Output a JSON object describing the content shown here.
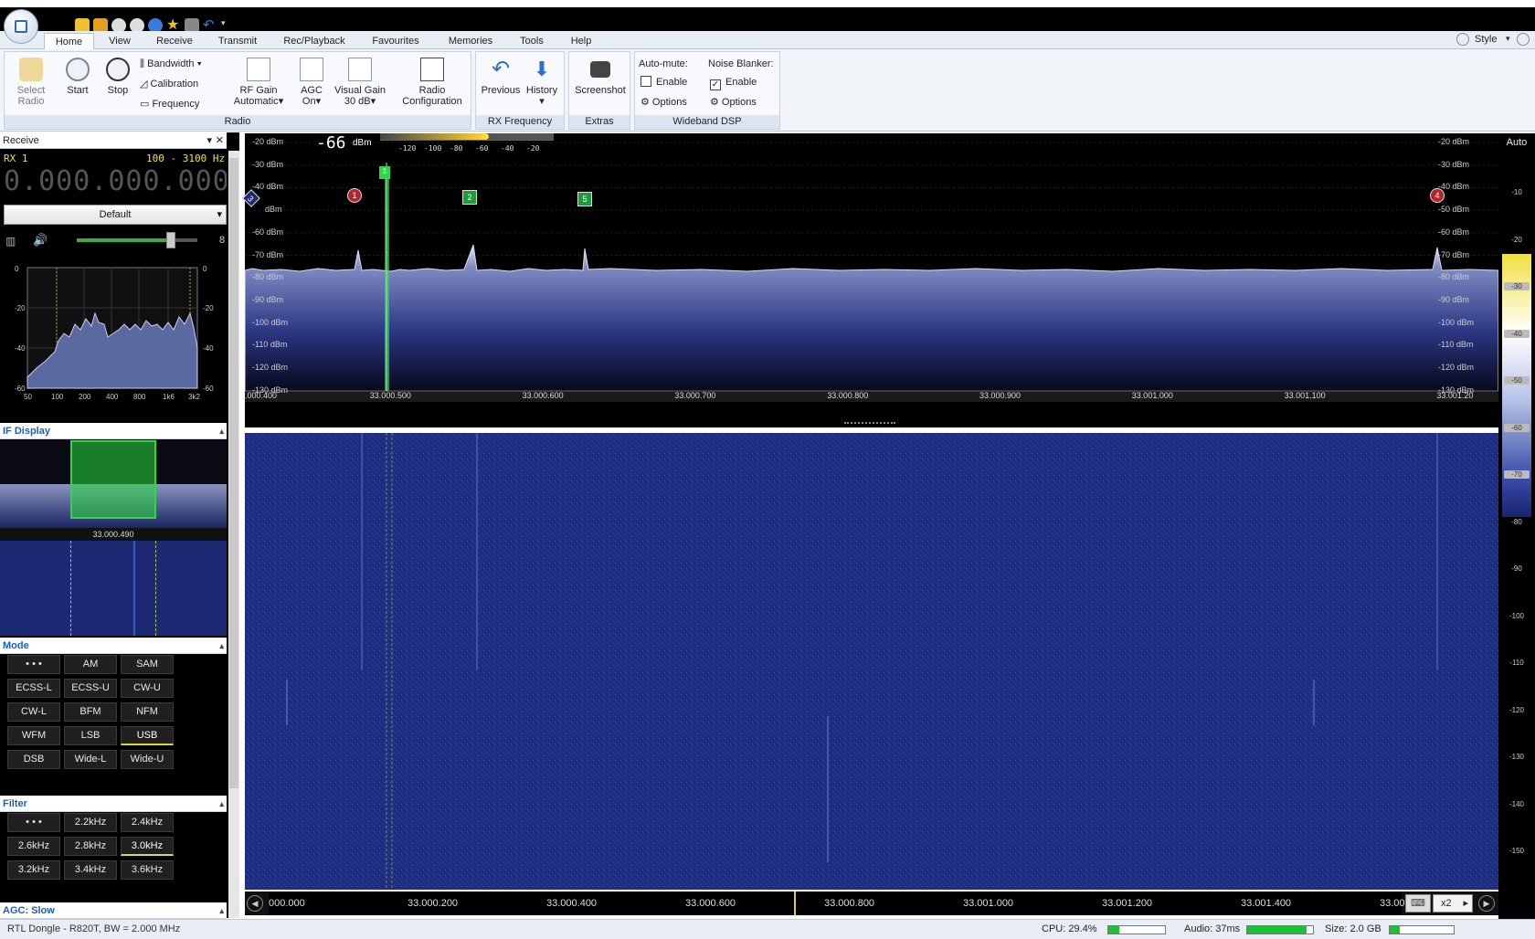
{
  "quick_access": [
    "home-icon",
    "folder-icon",
    "play-icon",
    "stop-icon",
    "add-icon",
    "favourite-icon",
    "camera-icon",
    "undo-icon"
  ],
  "tabs": [
    {
      "label": "Home"
    },
    {
      "label": "View"
    },
    {
      "label": "Receive"
    },
    {
      "label": "Transmit"
    },
    {
      "label": "Rec/Playback"
    },
    {
      "label": "Favourites"
    },
    {
      "label": "Memories"
    },
    {
      "label": "Tools"
    },
    {
      "label": "Help"
    }
  ],
  "style_label": "Style",
  "ribbon": {
    "select_radio": "Select\nRadio",
    "start": "Start",
    "stop": "Stop",
    "bandwidth": "Bandwidth",
    "calibration": "Calibration",
    "frequency": "Frequency",
    "rf_gain": "RF Gain",
    "rf_gain_val": "Automatic",
    "agc": "AGC",
    "agc_val": "On",
    "visual_gain": "Visual Gain",
    "visual_gain_val": "30 dB",
    "radio_config": "Radio",
    "radio_config2": "Configuration",
    "radio_group": "Radio",
    "previous": "Previous",
    "history": "History",
    "rxfreq_group": "RX Frequency",
    "screenshot": "Screenshot",
    "extras_group": "Extras",
    "automute": "Auto-mute:",
    "automute_enable": "Enable",
    "automute_options": "Options",
    "noise_blanker": "Noise Blanker:",
    "nb_enable": "Enable",
    "nb_options": "Options",
    "wideband_group": "Wideband DSP"
  },
  "receive": {
    "title": "Receive",
    "rx": "RX 1",
    "bw": "100 - 3100 Hz",
    "freq": "0.000.000.000",
    "preset": "Default",
    "volume": 0.78,
    "vol_label": "8"
  },
  "audio_spectrum": {
    "left_scale": [
      "0",
      "-20",
      "-40",
      "-60"
    ],
    "right_scale": [
      "0",
      "-20",
      "-40",
      "-60"
    ],
    "freqs": [
      "50",
      "100",
      "200",
      "400",
      "800",
      "1k6",
      "3k2"
    ]
  },
  "if_display": {
    "title": "IF Display",
    "freq": "33.000.490"
  },
  "mode": {
    "title": "Mode",
    "buttons": [
      "• • •",
      "AM",
      "SAM",
      "ECSS-L",
      "ECSS-U",
      "CW-U",
      "CW-L",
      "BFM",
      "NFM",
      "WFM",
      "LSB",
      "USB",
      "DSB",
      "Wide-L",
      "Wide-U"
    ],
    "selected": "USB"
  },
  "filter": {
    "title": "Filter",
    "buttons": [
      "• • •",
      "2.2kHz",
      "2.4kHz",
      "2.6kHz",
      "2.8kHz",
      "3.0kHz",
      "3.2kHz",
      "3.4kHz",
      "3.6kHz"
    ],
    "selected": "3.0kHz"
  },
  "agc_label": "AGC: Slow",
  "spectrum": {
    "signal_value": "-66",
    "signal_unit": "dBm",
    "smeter_ticks": [
      "-120",
      "-100",
      "-80",
      "-60",
      "-40",
      "-20"
    ],
    "dbm_labels": [
      "-20 dBm",
      "-30 dBm",
      "-40 dBm",
      "-50 dBm",
      "-60 dBm",
      "-70 dBm",
      "-80 dBm",
      "-90 dBm",
      "-100 dBm",
      "-110 dBm",
      "-120 dBm",
      "-130 dBm"
    ],
    "dbm_left_partial": "dBm",
    "freq_labels": [
      ".000.400",
      "33.000.500",
      "33.000.600",
      "33.000.700",
      "33.000.800",
      "33.000.900",
      "33.001.000",
      "33.001.100",
      "33.001.20"
    ],
    "markers": [
      {
        "id": "1",
        "kind": "circle",
        "color": "#b3262c"
      },
      {
        "id": "2",
        "kind": "square",
        "color": "#1f9a3a"
      },
      {
        "id": "5",
        "kind": "square",
        "color": "#1f9a3a"
      },
      {
        "id": "4",
        "kind": "circle",
        "color": "#b3262c"
      },
      {
        "id": "3",
        "kind": "diamond",
        "color": "#1c2a6e"
      }
    ],
    "tuned_marker": "1"
  },
  "right_scale": {
    "auto_label": "Auto",
    "labels": [
      "-10",
      "-20",
      "-30",
      "-40",
      "-50",
      "-60",
      "-70",
      "-80",
      "-90",
      "-100",
      "-110",
      "-120",
      "-130",
      "-140",
      "-150"
    ]
  },
  "bottom_axis": {
    "labels": [
      "000.000",
      "33.000.200",
      "33.000.400",
      "33.000.600",
      "33.000.800",
      "33.001.000",
      "33.001.200",
      "33.001.400",
      "33.001.6"
    ],
    "zoom": "x2"
  },
  "status": {
    "device": "RTL Dongle - R820T, BW = 2.000 MHz",
    "cpu": "CPU: 29.4%",
    "cpu_level": 0.2,
    "audio": "Audio: 37ms",
    "audio_level": 0.9,
    "size": "Size: 2.0 GB",
    "size_level": 0.15
  }
}
